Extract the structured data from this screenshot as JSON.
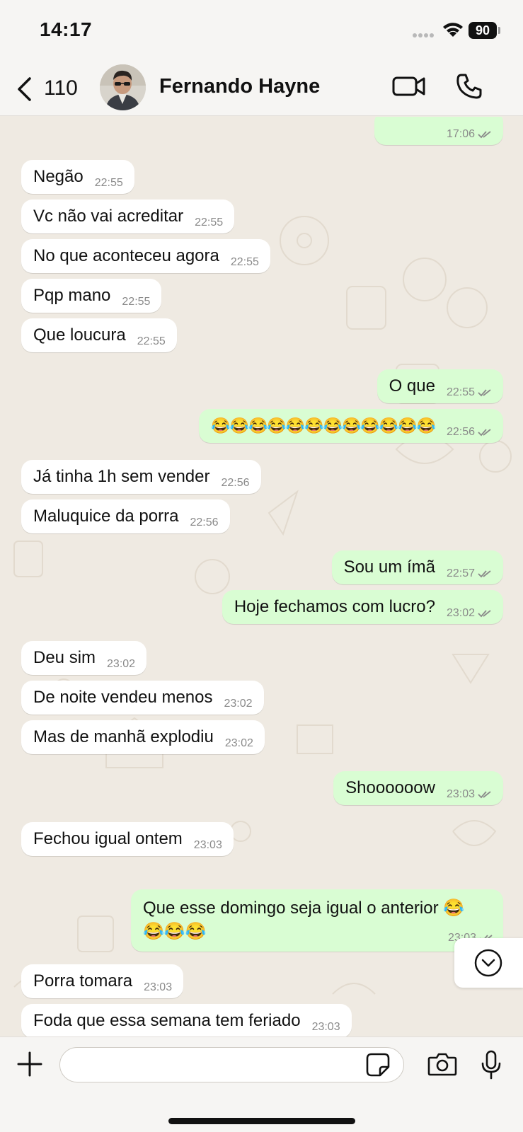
{
  "status_bar": {
    "time": "14:17",
    "battery": "90"
  },
  "header": {
    "back_count": "110",
    "contact_name": "Fernando Hayne"
  },
  "messages": [
    {
      "text": "",
      "time": "17:06",
      "dir": "out"
    },
    {
      "text": "Negão",
      "time": "22:55",
      "dir": "in"
    },
    {
      "text": "Vc não vai acreditar",
      "time": "22:55",
      "dir": "in"
    },
    {
      "text": "No que aconteceu agora",
      "time": "22:55",
      "dir": "in"
    },
    {
      "text": "Pqp mano",
      "time": "22:55",
      "dir": "in"
    },
    {
      "text": "Que loucura",
      "time": "22:55",
      "dir": "in"
    },
    {
      "text": "O que",
      "time": "22:55",
      "dir": "out"
    },
    {
      "text": "😂😂😂😂😂😂😂😂😂😂😂😂",
      "time": "22:56",
      "dir": "out"
    },
    {
      "text": "Já tinha 1h sem vender",
      "time": "22:56",
      "dir": "in"
    },
    {
      "text": "Maluquice da porra",
      "time": "22:56",
      "dir": "in"
    },
    {
      "text": "Sou um ímã",
      "time": "22:57",
      "dir": "out"
    },
    {
      "text": "Hoje fechamos com lucro?",
      "time": "23:02",
      "dir": "out"
    },
    {
      "text": "Deu sim",
      "time": "23:02",
      "dir": "in"
    },
    {
      "text": "De noite vendeu menos",
      "time": "23:02",
      "dir": "in"
    },
    {
      "text": "Mas de manhã explodiu",
      "time": "23:02",
      "dir": "in"
    },
    {
      "text": "Shoooooow",
      "time": "23:03",
      "dir": "out"
    },
    {
      "text": "Fechou igual ontem",
      "time": "23:03",
      "dir": "in"
    },
    {
      "text": "Que esse domingo seja igual o anterior 😂😂😂😂",
      "time": "23:03",
      "dir": "out"
    },
    {
      "text": "Porra tomara",
      "time": "23:03",
      "dir": "in"
    },
    {
      "text": "Foda que essa semana tem feriado",
      "time": "23:03",
      "dir": "in"
    }
  ],
  "composer": {
    "placeholder": "",
    "value": ""
  },
  "icons": {
    "back": "chevron-left-icon",
    "video": "video-camera-icon",
    "call": "phone-icon",
    "scroll": "chevron-down-circle-icon",
    "attach": "plus-icon",
    "sticker": "sticker-icon",
    "camera": "camera-icon",
    "mic": "microphone-icon"
  },
  "colors": {
    "chat_background": "#efeae2",
    "incoming_bubble": "#ffffff",
    "outgoing_bubble": "#d9fdd3",
    "read_ticks": "#8a8a8a"
  }
}
